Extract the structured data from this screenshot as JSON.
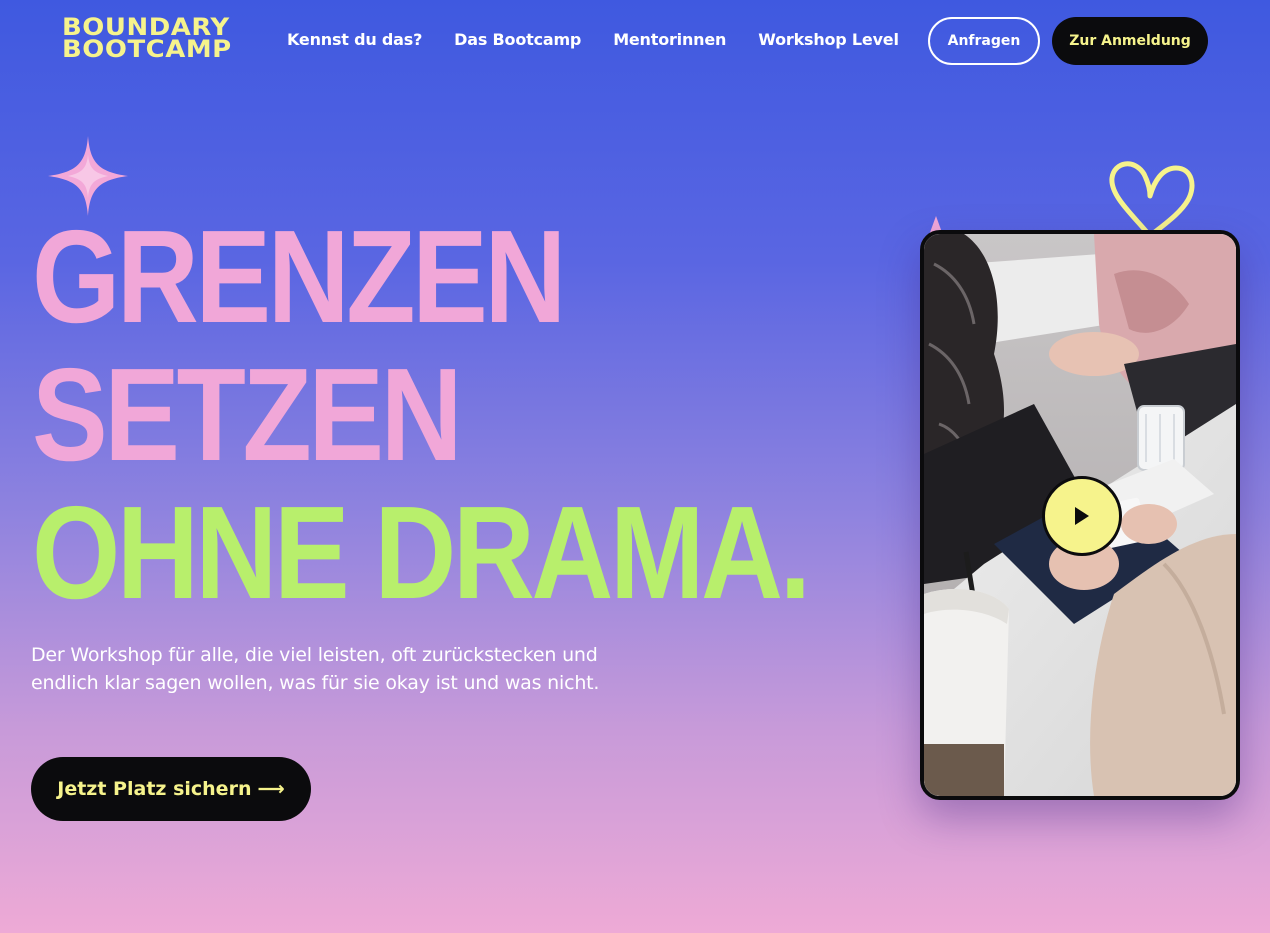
{
  "header": {
    "logo_line1": "BOUNDARY",
    "logo_line2": "BOOTCAMP",
    "nav": [
      {
        "label": "Kennst du das?"
      },
      {
        "label": "Das Bootcamp"
      },
      {
        "label": "Mentorinnen"
      },
      {
        "label": "Workshop Level"
      }
    ],
    "inquire_label": "Anfragen",
    "register_label": "Zur Anmeldung"
  },
  "hero": {
    "headline_line1": "GRENZEN",
    "headline_line2": "SETZEN",
    "headline_line3": "OHNE DRAMA.",
    "subtext": "Der Workshop für alle, die viel leisten, oft zurückstecken und endlich klar sagen wollen, was für sie okay ist und was nicht.",
    "cta_label": "Jetzt Platz sichern",
    "cta_arrow": "⟶"
  },
  "video": {
    "play_icon": "play-icon"
  },
  "colors": {
    "accent_yellow": "#f6f38c",
    "headline_pink": "#f1a7d8",
    "headline_green": "#b8ef6c",
    "button_dark": "#0b0b0d"
  }
}
